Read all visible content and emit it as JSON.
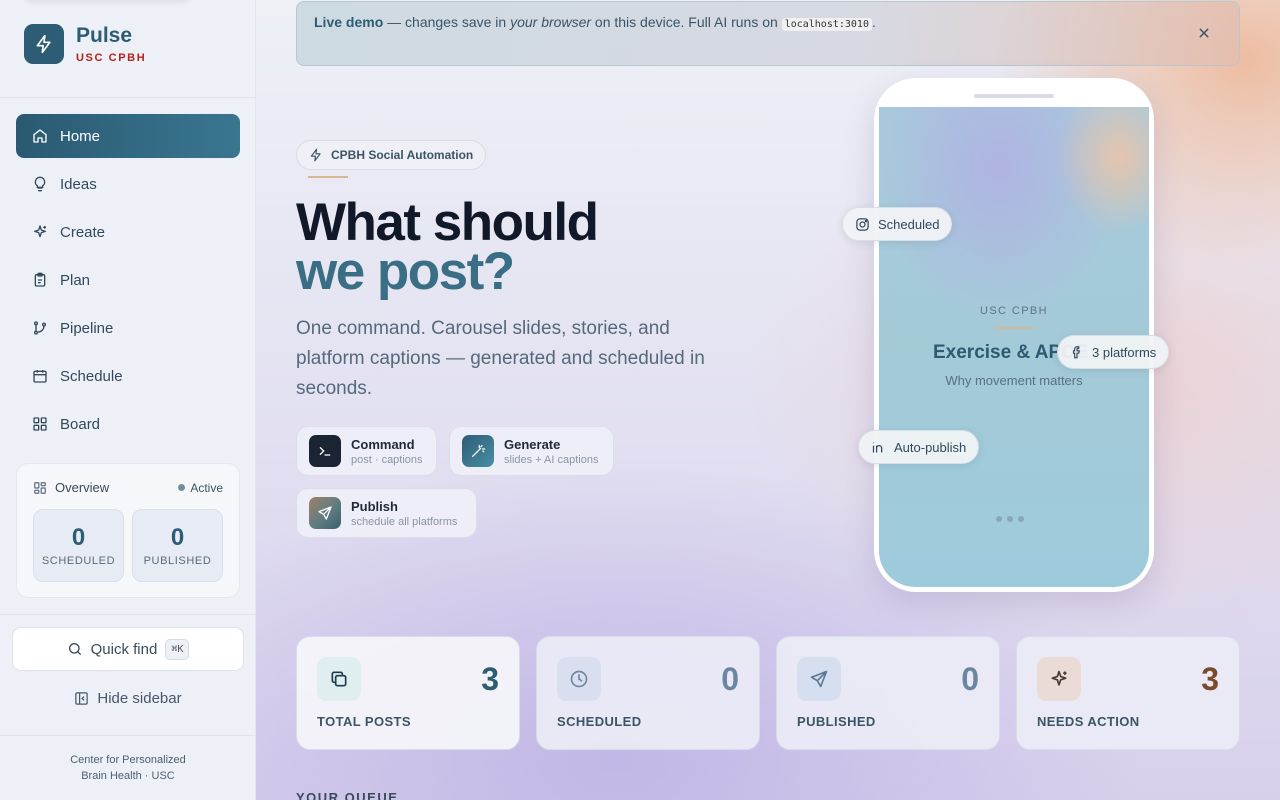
{
  "sidebar": {
    "brand": {
      "name": "Pulse",
      "subtitle": "USC CPBH"
    },
    "nav": [
      {
        "label": "Home",
        "icon": "home-icon",
        "active": true
      },
      {
        "label": "Ideas",
        "icon": "lightbulb-icon"
      },
      {
        "label": "Create",
        "icon": "sparkles-icon"
      },
      {
        "label": "Plan",
        "icon": "clipboard-icon"
      },
      {
        "label": "Pipeline",
        "icon": "git-branch-icon"
      },
      {
        "label": "Schedule",
        "icon": "calendar-icon"
      },
      {
        "label": "Board",
        "icon": "grid-icon"
      }
    ],
    "overview": {
      "title": "Overview",
      "status": "Active",
      "scheduled": {
        "value": "0",
        "label": "SCHEDULED"
      },
      "published": {
        "value": "0",
        "label": "PUBLISHED"
      }
    },
    "quick_find": {
      "label": "Quick find",
      "shortcut": "⌘K"
    },
    "hide_sidebar": "Hide sidebar",
    "footer": {
      "line1": "Center for Personalized",
      "line2": "Brain Health · USC"
    }
  },
  "banner": {
    "strong": "Live demo",
    "part1": " — changes save in ",
    "em": "your browser",
    "part2": " on this device. Full AI runs on ",
    "code": "localhost:3010",
    "part3": "."
  },
  "hero": {
    "tag": "CPBH Social Automation",
    "headline_line1": "What should",
    "headline_line2": "we post?",
    "subtext": "One command. Carousel slides, stories, and platform captions — generated and scheduled in seconds.",
    "features": [
      {
        "title": "Command",
        "subtitle": "post · captions"
      },
      {
        "title": "Generate",
        "subtitle": "slides + AI captions"
      },
      {
        "title": "Publish",
        "subtitle": "schedule all platforms"
      }
    ]
  },
  "phone": {
    "brand": "USC CPBH",
    "title": "Exercise & APOE",
    "subtitle": "Why movement matters",
    "chips": {
      "scheduled": "Scheduled",
      "platforms": "3 platforms",
      "autopublish": "Auto-publish"
    }
  },
  "stats": [
    {
      "value": "3",
      "label": "TOTAL POSTS",
      "color": "#2c5d74"
    },
    {
      "value": "0",
      "label": "SCHEDULED",
      "color": "#6b86a0"
    },
    {
      "value": "0",
      "label": "PUBLISHED",
      "color": "#6b86a0"
    },
    {
      "value": "3",
      "label": "NEEDS ACTION",
      "color": "#7a4a2a"
    }
  ],
  "queue_heading": "YOUR QUEUE"
}
